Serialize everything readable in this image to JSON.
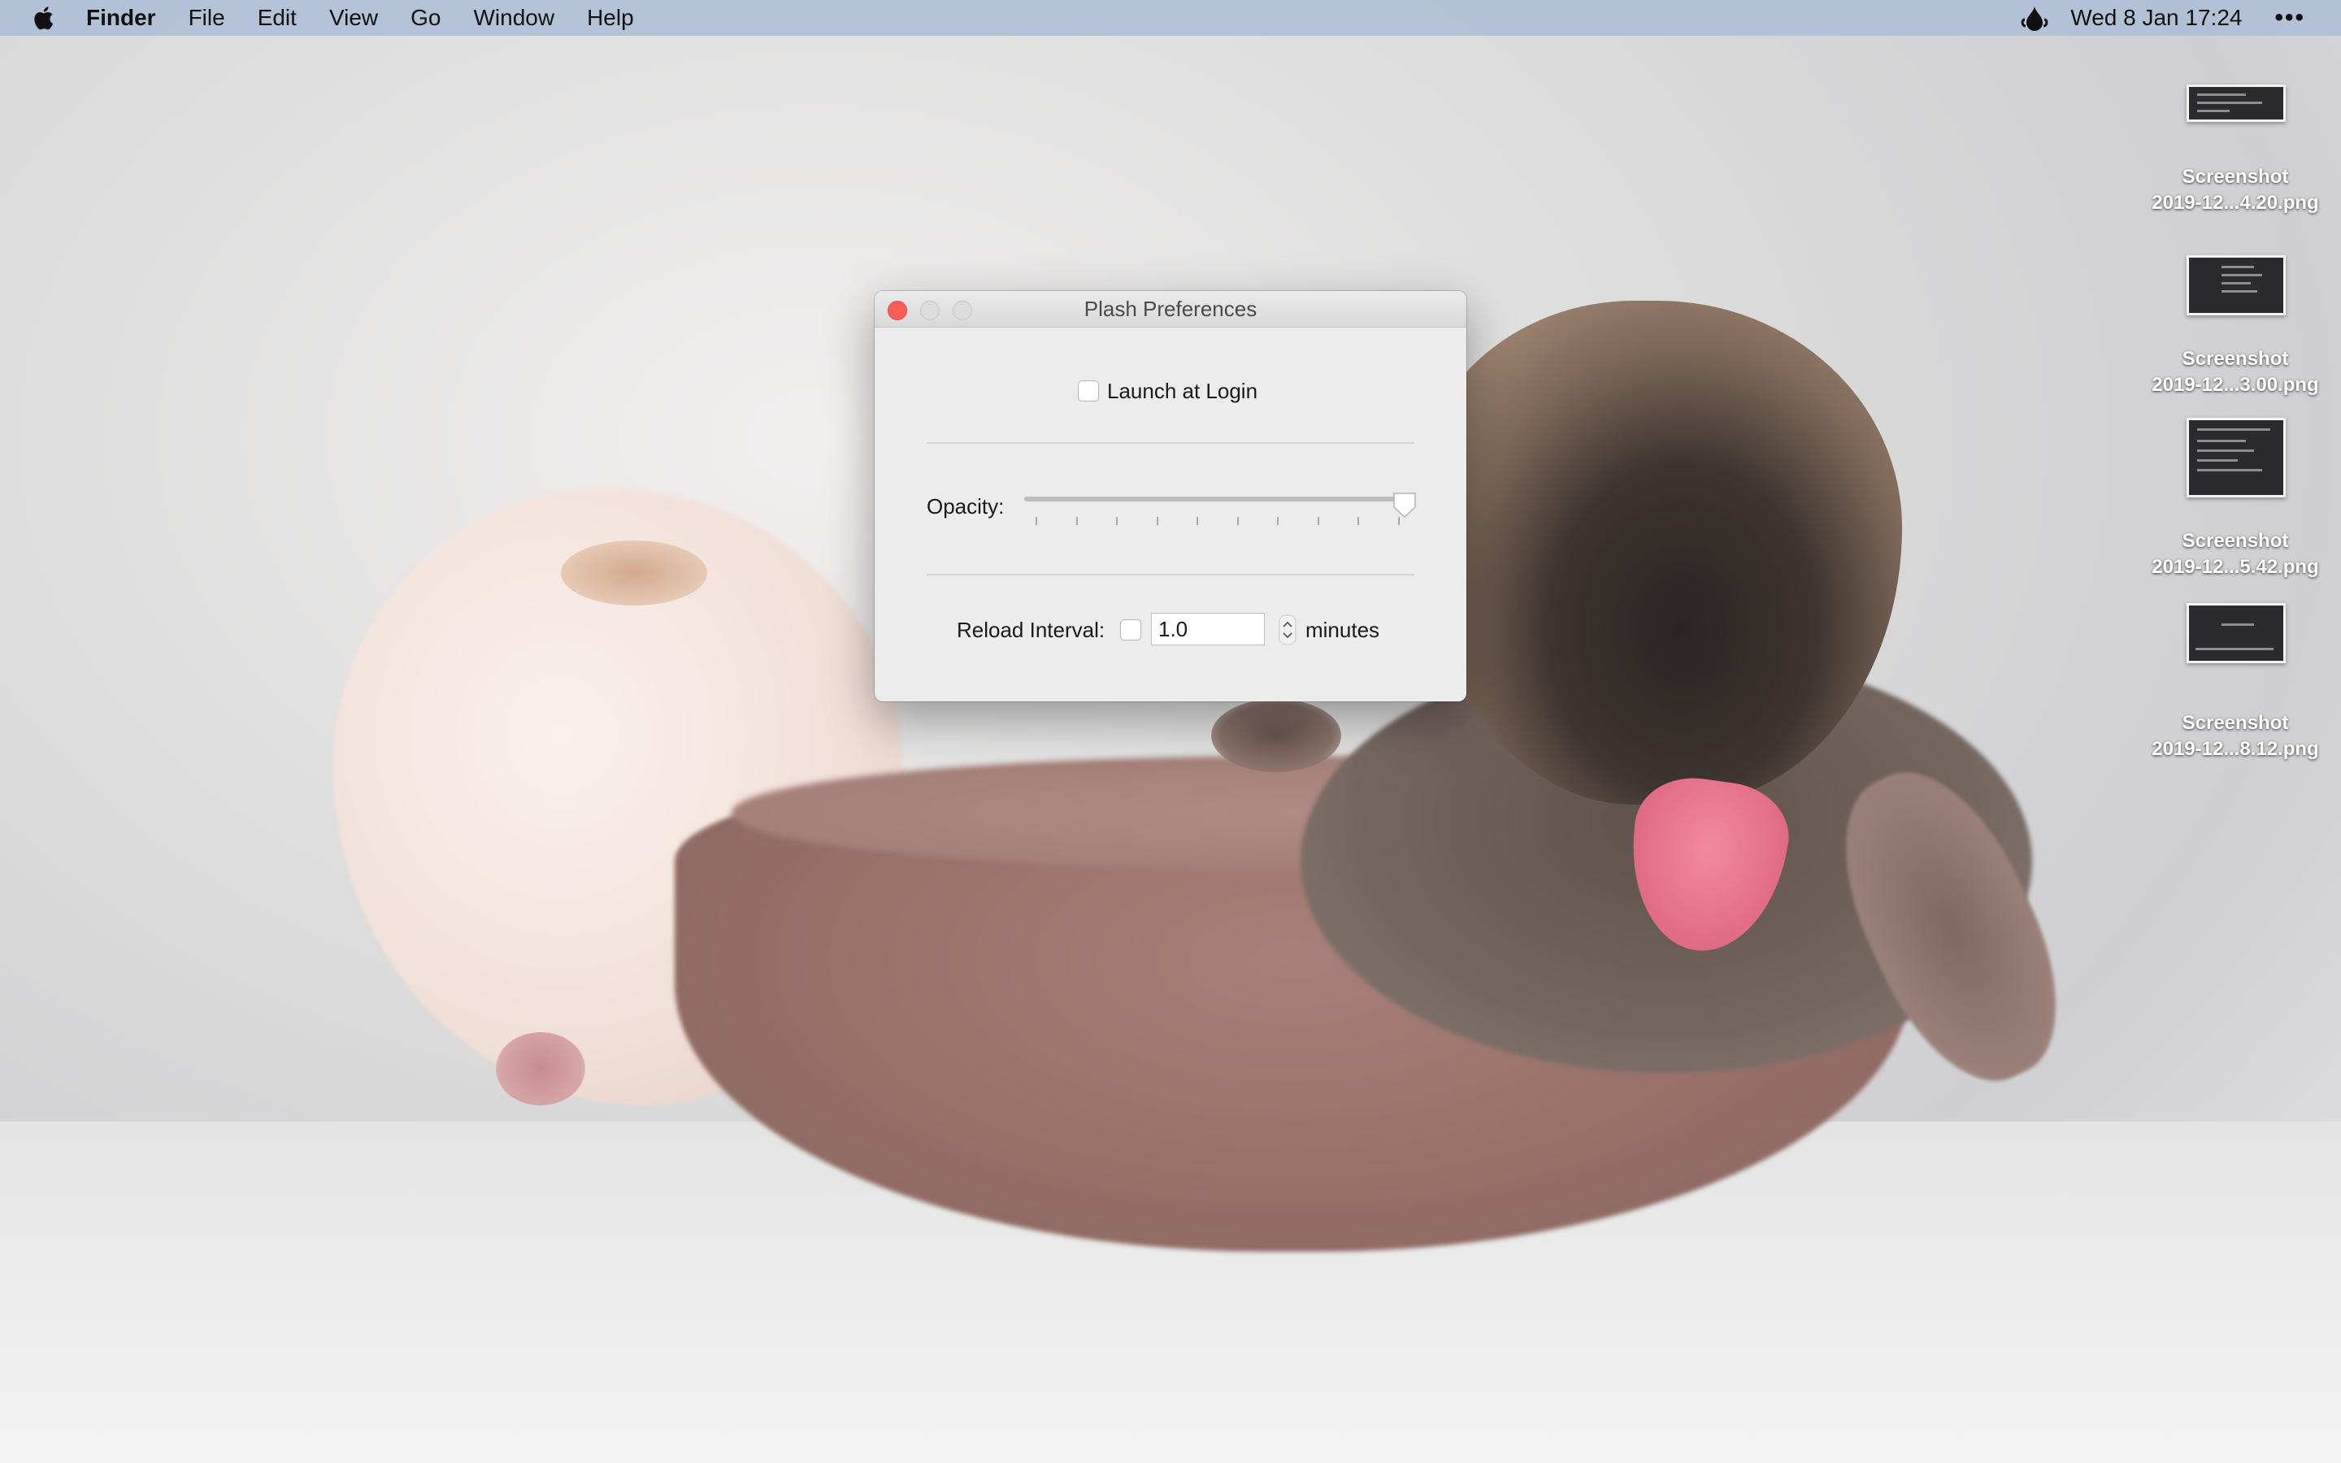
{
  "menubar": {
    "app_name": "Finder",
    "items": [
      "File",
      "Edit",
      "View",
      "Go",
      "Window",
      "Help"
    ],
    "clock": "Wed 8 Jan 17:24",
    "more": "•••"
  },
  "desktop": {
    "icons": [
      {
        "line1": "Screenshot",
        "line2": "2019-12...4.20.png"
      },
      {
        "line1": "Screenshot",
        "line2": "2019-12...3.00.png"
      },
      {
        "line1": "Screenshot",
        "line2": "2019-12...5.42.png"
      },
      {
        "line1": "Screenshot",
        "line2": "2019-12...8.12.png"
      }
    ]
  },
  "window": {
    "title": "Plash Preferences",
    "launch_at_login": {
      "label": "Launch at Login",
      "checked": false
    },
    "opacity": {
      "label": "Opacity:",
      "value": 1.0,
      "tick_count": 10
    },
    "reload_interval": {
      "label": "Reload Interval:",
      "checked": false,
      "value": "1.0",
      "unit": "minutes"
    }
  },
  "colors": {
    "menubar": "#b0bfd6",
    "close_button": "#fc5f57",
    "window_bg": "#ececec"
  },
  "icons": {
    "apple": "apple-logo-icon",
    "status": "plash-drop-icon"
  }
}
